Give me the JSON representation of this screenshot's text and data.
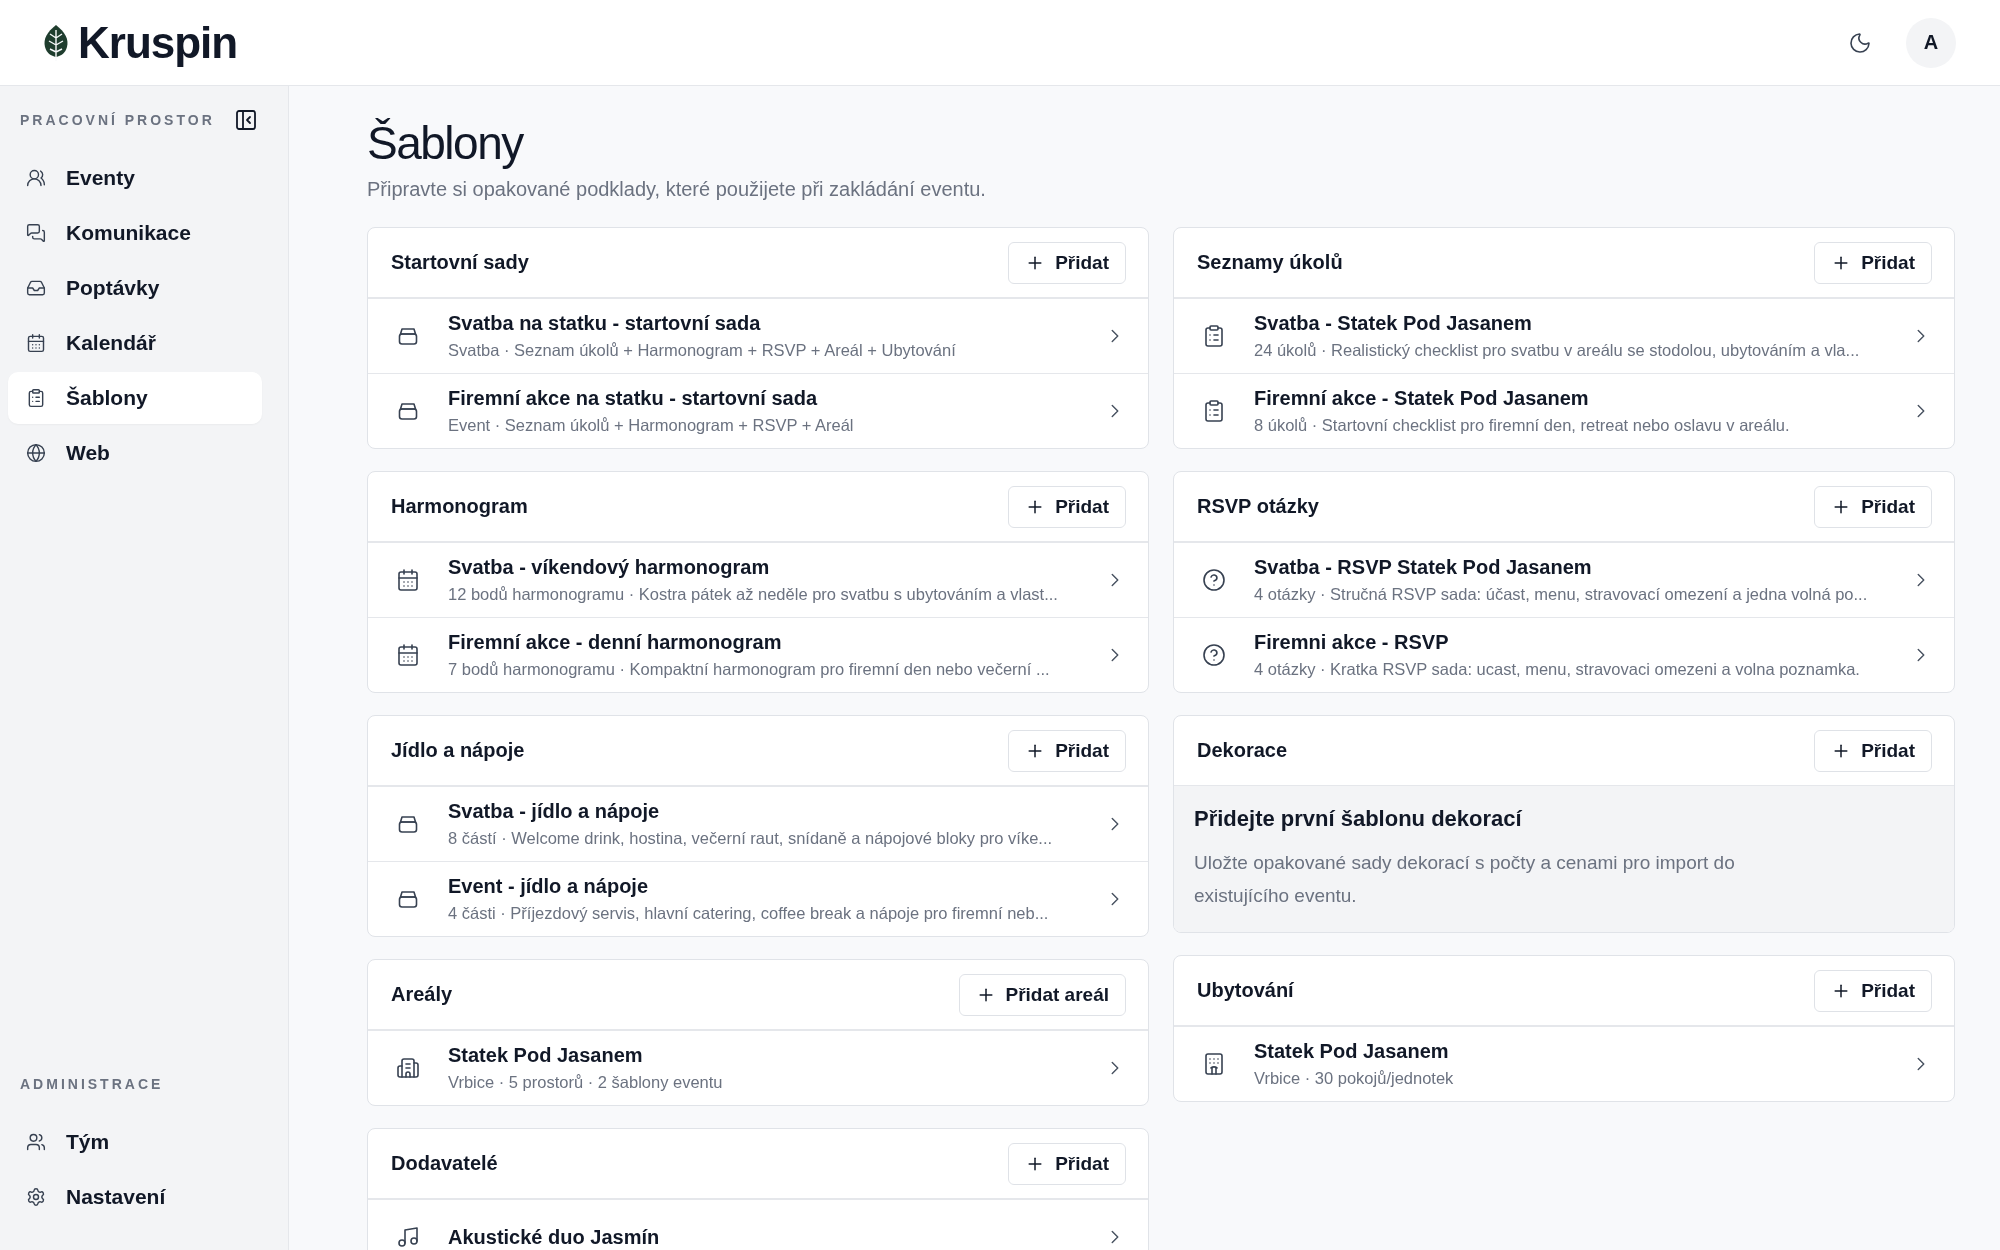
{
  "header": {
    "logo": "Kruspin",
    "avatar": "A"
  },
  "sidebar": {
    "groups": [
      {
        "label": "PRACOVNÍ PROSTOR",
        "collapse_button": true,
        "items": [
          {
            "kind": "events",
            "label": "Eventy",
            "selected": false
          },
          {
            "kind": "messages",
            "label": "Komunikace",
            "selected": false
          },
          {
            "kind": "inbox",
            "label": "Poptávky",
            "selected": false
          },
          {
            "kind": "calendar",
            "label": "Kalendář",
            "selected": false
          },
          {
            "kind": "templates",
            "label": "Šablony",
            "selected": true
          },
          {
            "kind": "web",
            "label": "Web",
            "selected": false
          }
        ]
      },
      {
        "label": "ADMINISTRACE",
        "items": [
          {
            "kind": "team",
            "label": "Tým",
            "selected": false
          },
          {
            "kind": "settings",
            "label": "Nastavení",
            "selected": false
          }
        ]
      }
    ]
  },
  "page": {
    "title": "Šablony",
    "subtitle": "Připravte si opakované podklady, které použijete při zakládání eventu."
  },
  "columns": [
    {
      "sections": [
        {
          "kind": "starter",
          "title": "Startovní sady",
          "button": "Přidat",
          "items": [
            {
              "title": "Svatba na statku - startovní sada",
              "subtitle": "Svatba · Seznam úkolů + Harmonogram + RSVP + Areál + Ubytování"
            },
            {
              "title": "Firemní akce na statku - startovní sada",
              "subtitle": "Event · Seznam úkolů + Harmonogram + RSVP + Areál"
            }
          ]
        },
        {
          "kind": "schedule",
          "title": "Harmonogram",
          "button": "Přidat",
          "items": [
            {
              "title": "Svatba - víkendový harmonogram",
              "subtitle": "12 bodů harmonogramu · Kostra pátek až neděle pro svatbu s ubytováním a vlast..."
            },
            {
              "title": "Firemní akce - denní harmonogram",
              "subtitle": "7 bodů harmonogramu · Kompaktní harmonogram pro firemní den nebo večerní ..."
            }
          ]
        },
        {
          "kind": "catering",
          "title": "Jídlo a nápoje",
          "button": "Přidat",
          "items": [
            {
              "title": "Svatba - jídlo a nápoje",
              "subtitle": "8 částí · Welcome drink, hostina, večerní raut, snídaně a nápojové bloky pro víke..."
            },
            {
              "title": "Event - jídlo a nápoje",
              "subtitle": "4 části · Příjezdový servis, hlavní catering, coffee break a nápoje pro firemní neb..."
            }
          ]
        },
        {
          "kind": "venue",
          "title": "Areály",
          "button": "Přidat areál",
          "items": [
            {
              "title": "Statek Pod Jasanem",
              "subtitle": "Vrbice · 5 prostorů · 2 šablony eventu"
            }
          ]
        },
        {
          "kind": "supplier",
          "title": "Dodavatelé",
          "button": "Přidat",
          "items": [
            {
              "title": "Akustické duo Jasmín"
            }
          ]
        }
      ]
    },
    {
      "sections": [
        {
          "kind": "tasks",
          "title": "Seznamy úkolů",
          "button": "Přidat",
          "items": [
            {
              "title": "Svatba - Statek Pod Jasanem",
              "subtitle": "24 úkolů · Realistický checklist pro svatbu v areálu se stodolou, ubytováním a vla..."
            },
            {
              "title": "Firemní akce - Statek Pod Jasanem",
              "subtitle": "8 úkolů · Startovní checklist pro firemní den, retreat nebo oslavu v areálu."
            }
          ]
        },
        {
          "kind": "rsvp",
          "title": "RSVP otázky",
          "button": "Přidat",
          "items": [
            {
              "title": "Svatba - RSVP Statek Pod Jasanem",
              "subtitle": "4 otázky · Stručná RSVP sada: účast, menu, stravovací omezení a jedna volná po..."
            },
            {
              "title": "Firemni akce - RSVP",
              "subtitle": "4 otázky · Kratka RSVP sada: ucast, menu, stravovaci omezeni a volna poznamka."
            }
          ]
        },
        {
          "title": "Dekorace",
          "button": "Přidat",
          "empty_state": {
            "title": "Přidejte první šablonu dekorací",
            "text": "Uložte opakované sady dekorací s počty a cenami pro import do existujícího eventu."
          }
        },
        {
          "kind": "lodging",
          "title": "Ubytování",
          "button": "Přidat",
          "items": [
            {
              "title": "Statek Pod Jasanem",
              "subtitle": "Vrbice · 30 pokojů/jednotek"
            }
          ]
        }
      ]
    }
  ]
}
